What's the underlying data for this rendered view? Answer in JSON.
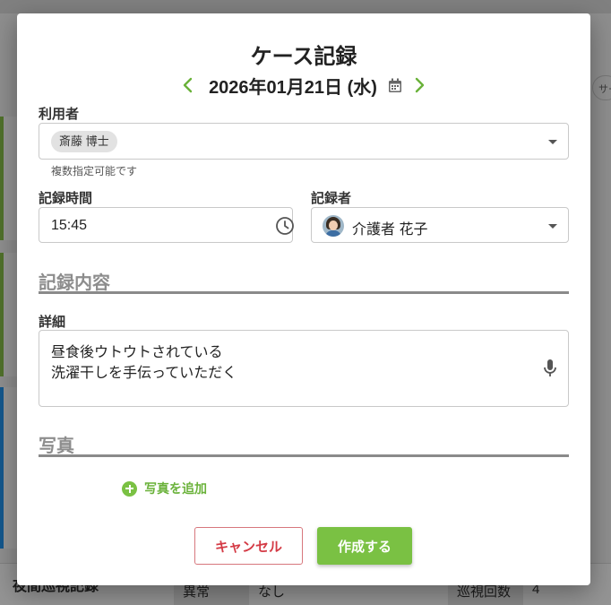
{
  "background": {
    "search_stub": "サー",
    "bottom_card": {
      "title": "夜間巡視記録",
      "cells": [
        "異常",
        "なし",
        "巡視回数",
        "4"
      ]
    }
  },
  "dialog": {
    "title": "ケース記録",
    "date": {
      "text": "2026年01月21日 (水)",
      "prev_icon": "chevron-left-icon",
      "next_icon": "chevron-right-icon",
      "calendar_icon": "calendar-icon"
    },
    "user": {
      "label": "利用者",
      "chip": "斎藤 博士",
      "hint": "複数指定可能です"
    },
    "record_time": {
      "label": "記録時間",
      "value": "15:45",
      "icon": "clock-icon"
    },
    "recorder": {
      "label": "記録者",
      "value": "介護者 花子"
    },
    "content_section": "記録内容",
    "detail": {
      "label": "詳細",
      "lines": [
        "昼食後ウトウトされている",
        "洗濯干しを手伝っていただく"
      ],
      "icon": "microphone-icon"
    },
    "photo_section": "写真",
    "add_photo": "写真を追加",
    "buttons": {
      "cancel": "キャンセル",
      "create": "作成する"
    },
    "colors": {
      "accent": "#7ac143",
      "danger": "#d43a45"
    }
  }
}
